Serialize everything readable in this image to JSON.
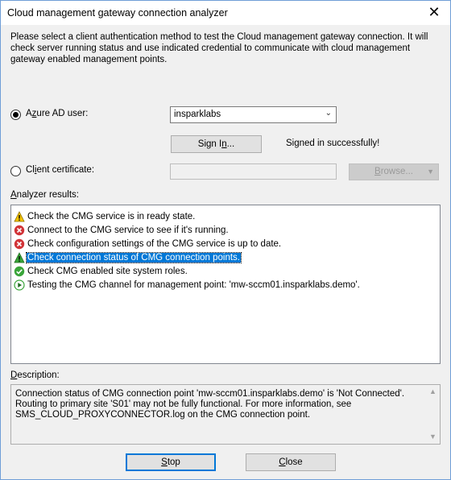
{
  "window": {
    "title": "Cloud management gateway connection analyzer"
  },
  "intro": "Please select a client authentication method to test the Cloud management gateway connection. It will check server running status and use indicated credential to communicate with cloud management gateway enabled management points.",
  "azure": {
    "label_pre": "A",
    "label_u": "z",
    "label_post": "ure AD user:",
    "selected": true,
    "combo_value": "insparklabs",
    "signin_pre": "Sign I",
    "signin_u": "n",
    "signin_post": "...",
    "status": "Signed in successfully!"
  },
  "client_cert": {
    "label_pre": "Cl",
    "label_u": "i",
    "label_post": "ent certificate:",
    "selected": false,
    "value": "",
    "browse_pre": "",
    "browse_u": "B",
    "browse_post": "rowse..."
  },
  "results": {
    "label_pre": "",
    "label_u": "A",
    "label_post": "nalyzer results:",
    "items": [
      {
        "icon": "warning",
        "text": "Check the CMG service is in ready state."
      },
      {
        "icon": "error",
        "text": "Connect to the CMG service to see if it's running."
      },
      {
        "icon": "error",
        "text": "Check configuration settings of the CMG service is up to date."
      },
      {
        "icon": "warning",
        "text": "Check connection status of CMG connection points.",
        "selected": true
      },
      {
        "icon": "success",
        "text": "Check CMG enabled site system roles."
      },
      {
        "icon": "running",
        "text": "Testing the CMG channel for management point: 'mw-sccm01.insparklabs.demo'."
      }
    ]
  },
  "description": {
    "label_pre": "",
    "label_u": "D",
    "label_post": "escription:",
    "text": "Connection status of CMG connection point 'mw-sccm01.insparklabs.demo' is 'Not Connected'. Routing to primary site 'S01' may not be fully functional. For more information, see SMS_CLOUD_PROXYCONNECTOR.log on the CMG connection point."
  },
  "buttons": {
    "stop_u": "S",
    "stop_post": "top",
    "close_u": "C",
    "close_post": "lose"
  },
  "colors": {
    "selection": "#0078d7",
    "warning": "#f5c400",
    "error": "#d13438",
    "success": "#3aa53a"
  }
}
